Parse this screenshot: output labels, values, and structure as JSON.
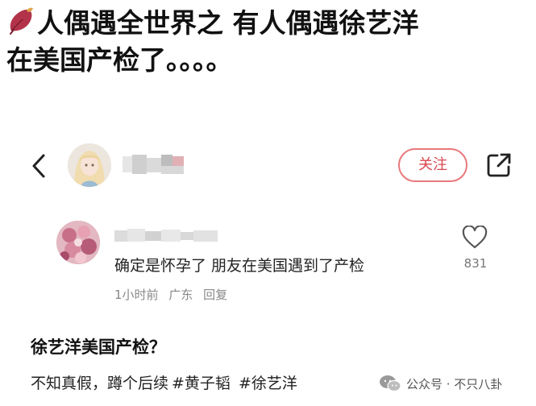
{
  "headline": {
    "line1": "人偶遇全世界之 有人偶遇徐艺洋",
    "line2": "在美国产检了。。。。"
  },
  "profile_bar": {
    "follow_label": "关注"
  },
  "comment": {
    "text": "确定是怀孕了 朋友在美国遇到了产检",
    "time": "1小时前",
    "location": "广东",
    "reply_label": "回复",
    "like_count": "831"
  },
  "post": {
    "title": "徐艺洋美国产检？",
    "body": "不知真假，蹲个后续",
    "tags": [
      "#黄子韬",
      "#徐艺洋"
    ]
  },
  "watermark": {
    "text": "公众号 · 不只八卦"
  },
  "icons": {
    "headline_emoji": "sweet-potato-icon",
    "back": "chevron-left-icon",
    "share": "share-icon",
    "like": "heart-icon",
    "watermark": "wechat-icon"
  },
  "colors": {
    "follow_accent": "#d9474e",
    "meta_gray": "#888888"
  }
}
